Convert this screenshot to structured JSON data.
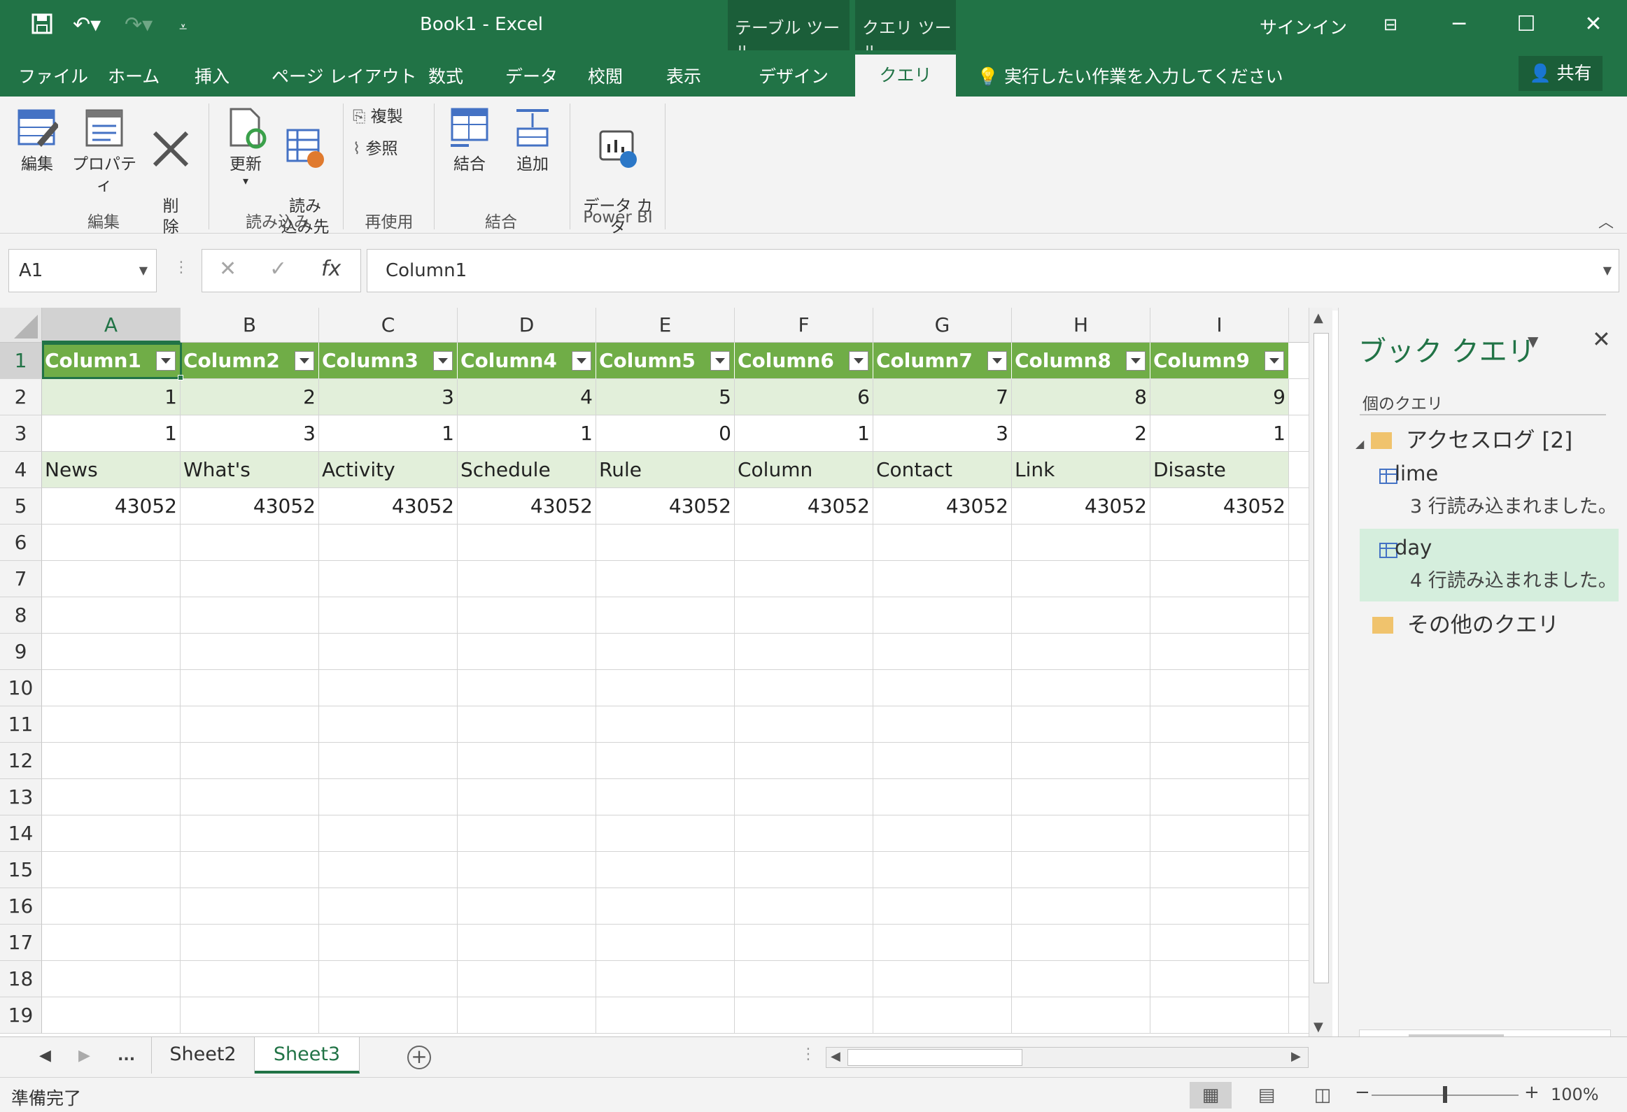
{
  "window": {
    "title": "Book1  -  Excel",
    "signin": "サインイン",
    "context_tab_table": "テーブル ツール",
    "context_tab_query": "クエリ ツール"
  },
  "ribbon_tabs": [
    "ファイル",
    "ホーム",
    "挿入",
    "ページ レイアウト",
    "数式",
    "データ",
    "校閲",
    "表示",
    "デザイン"
  ],
  "active_tab": "クエリ",
  "tell_me": "実行したい作業を入力してください",
  "share": "共有",
  "ribbon": {
    "edit": "編集",
    "properties": "プロパティ",
    "delete": "削\n除",
    "refresh": "更新",
    "load_to": "読み\n込み先",
    "duplicate": "複製",
    "reference": "参照",
    "merge": "結合",
    "append": "追加",
    "send_catalog": "データ カタ\nログに送信",
    "groups": {
      "edit": "編集",
      "load": "読み込み",
      "reuse": "再使用",
      "combine": "結合",
      "powerbi": "Power BI"
    }
  },
  "formula_bar": {
    "name_box": "A1",
    "cancel": "✕",
    "enter": "✓",
    "fx": "fx",
    "value": "Column1"
  },
  "columns": [
    "A",
    "B",
    "C",
    "D",
    "E",
    "F",
    "G",
    "H",
    "I"
  ],
  "rows": [
    "1",
    "2",
    "3",
    "4",
    "5",
    "6",
    "7",
    "8",
    "9",
    "10",
    "11",
    "12",
    "13",
    "14",
    "15",
    "16",
    "17",
    "18",
    "19"
  ],
  "table": {
    "headers": [
      "Column1",
      "Column2",
      "Column3",
      "Column4",
      "Column5",
      "Column6",
      "Column7",
      "Column8",
      "Column9"
    ],
    "row2": [
      "1",
      "2",
      "3",
      "4",
      "5",
      "6",
      "7",
      "8",
      "9"
    ],
    "row3": [
      "1",
      "3",
      "1",
      "1",
      "0",
      "1",
      "3",
      "2",
      "1"
    ],
    "row4": [
      "News",
      "What's",
      "Activity",
      "Schedule",
      "Rule",
      "Column",
      "Contact",
      "Link",
      "Disaste"
    ],
    "row5": [
      "43052",
      "43052",
      "43052",
      "43052",
      "43052",
      "43052",
      "43052",
      "43052",
      "43052"
    ]
  },
  "query_pane": {
    "title": "ブック クエリ",
    "count_label": "個のクエリ",
    "folder1": "アクセスログ [2]",
    "q1_name": "lime",
    "q1_status": "3 行読み込まれました。",
    "q2_name": "day",
    "q2_status": "4 行読み込まれました。",
    "folder2": "その他のクエリ"
  },
  "sheets": {
    "more": "...",
    "tabs": [
      "Sheet2",
      "Sheet3"
    ],
    "active": "Sheet3"
  },
  "status": {
    "ready": "準備完了",
    "zoom": "100%"
  }
}
